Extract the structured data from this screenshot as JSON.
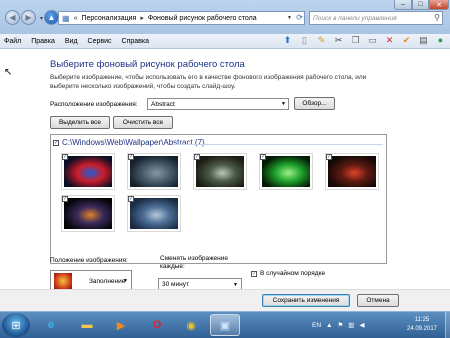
{
  "window": {
    "address": {
      "items": [
        "Персонализация",
        "Фоновый рисунок рабочего стола"
      ],
      "chevron": "«"
    },
    "search_placeholder": "Поиск в панели управления",
    "caption": {
      "minimize": "–",
      "maximize": "□",
      "close": "✕"
    }
  },
  "menu": [
    "Файл",
    "Правка",
    "Вид",
    "Сервис",
    "Справка"
  ],
  "page": {
    "heading": "Выберите фоновый рисунок рабочего стола",
    "description": "Выберите изображение, чтобы использовать его в качестве фонового изображения рабочего стола, или выберите несколько изображений, чтобы создать слайд-шоу.",
    "location_label": "Расположение изображения:",
    "location_value": "Abstract",
    "browse_label": "Обзор...",
    "select_all_label": "Выделить все",
    "clear_all_label": "Очистить все",
    "group_path": "C:\\Windows\\Web\\Wallpaper\\Abstract (7)",
    "position_label": "Положение изображения:",
    "position_value": "Заполнение",
    "interval_label": "Сменять изображение каждые:",
    "interval_value": "30 минут",
    "shuffle_label": "В случайном порядке",
    "shuffle_checked": true
  },
  "footer": {
    "save_label": "Сохранить изменения",
    "cancel_label": "Отмена"
  },
  "taskbar": {
    "tray_lang": "EN",
    "time": "11:25",
    "date": "24.09.2017",
    "apps": [
      "ie-icon",
      "explorer-icon",
      "media-player-icon",
      "opera-icon",
      "chrome-icon",
      "control-panel-icon"
    ]
  },
  "thumbnails": [
    {
      "checked": true,
      "colors": [
        "#0a0d24",
        "#cc1d2a",
        "#1e5fd8"
      ]
    },
    {
      "checked": true,
      "colors": [
        "#15202d",
        "#4d6070",
        "#8a96a4"
      ]
    },
    {
      "checked": true,
      "colors": [
        "#1b1b12",
        "#4a5a48",
        "#bfc7b5"
      ]
    },
    {
      "checked": true,
      "colors": [
        "#031a05",
        "#1fa32c",
        "#9ef08c"
      ]
    },
    {
      "checked": true,
      "colors": [
        "#140806",
        "#5e1a12",
        "#e2432b"
      ]
    },
    {
      "checked": true,
      "colors": [
        "#050508",
        "#3a2a5a",
        "#e0802a"
      ]
    },
    {
      "checked": true,
      "colors": [
        "#1a2b44",
        "#4b6d95",
        "#b7c9dc"
      ]
    }
  ]
}
